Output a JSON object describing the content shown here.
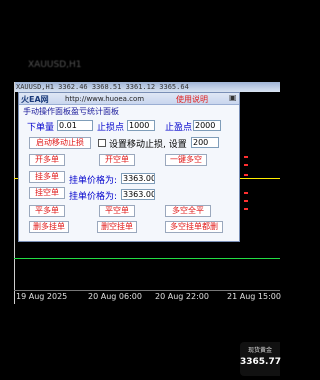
{
  "top_banner": {
    "title": "手动操作面板盈亏统计面板",
    "faded_text": "XAUUSD,H1"
  },
  "chart": {
    "symbol_info": "XAUUSD,H1  3362.46 3368.51 3361.12 3365.64",
    "x_axis_labels": [
      "19 Aug 2025",
      "20 Aug 06:00",
      "20 Aug 22:00",
      "21 Aug 15:00"
    ],
    "price_badge": {
      "title": "现货黄金",
      "value": "3365.77"
    },
    "colors": {
      "yellow_line": "#ffee00",
      "green_line": "#22dd44",
      "tick_red": "#ff3030"
    }
  },
  "panel": {
    "logo": "火EA网",
    "site": "http://www.huoea.com",
    "help": "使用说明",
    "minimize": "▣",
    "lots_label": "下单量",
    "lots_value": "0.01",
    "sl_label": "止损点",
    "sl_value": "1000",
    "tp_label": "止盈点",
    "tp_value": "2000",
    "trailing_button": "启动移动止损",
    "trailing_check_label": "设置移动止损, 设置",
    "trailing_value": "200",
    "buy_button": "开多单",
    "sell_button": "开空单",
    "close_all_button": "一键多空",
    "buy_limit_button": "挂多单",
    "sell_limit_button": "挂空单",
    "pending_price_label_1": "挂单价格为:",
    "pending_price_value_1": "3363.00",
    "pending_price_label_2": "挂单价格为:",
    "pending_price_value_2": "3363.00",
    "close_buy_button": "平多单",
    "close_sell_button": "平空单",
    "close_all_positions_button": "多空全平",
    "delete_buy_pending_button": "删多挂单",
    "delete_sell_pending_button": "删空挂单",
    "delete_all_pending_button": "多空挂单都删"
  }
}
